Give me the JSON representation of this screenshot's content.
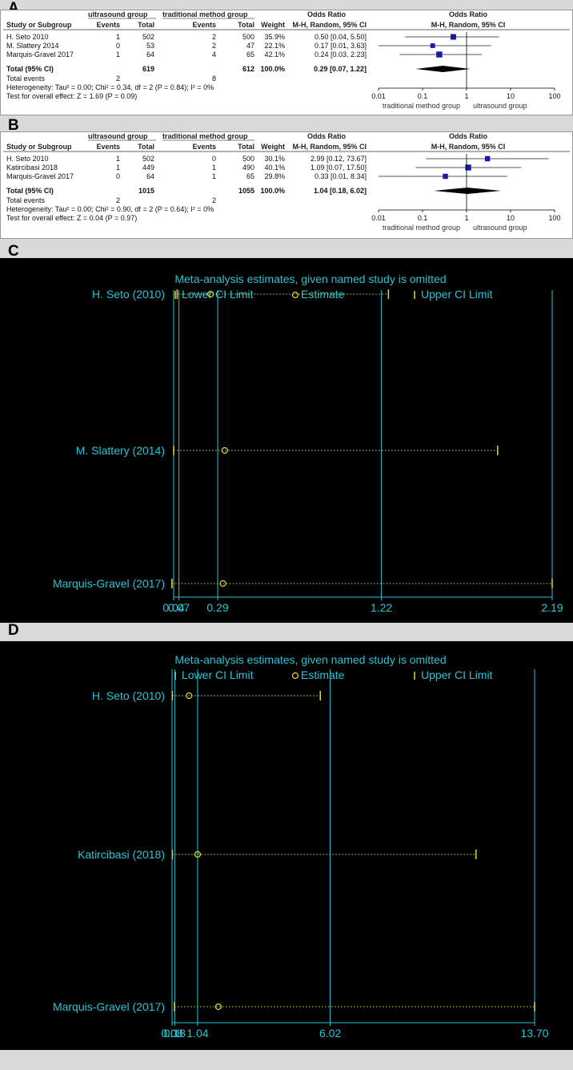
{
  "forest_plots": [
    {
      "panel": "A",
      "headers": {
        "group1": "ultrasound group",
        "group2": "traditional method group",
        "or_col": "Odds Ratio",
        "study": "Study or Subgroup",
        "events": "Events",
        "total": "Total",
        "weight": "Weight",
        "method": "M-H, Random, 95% CI"
      },
      "studies": [
        {
          "name": "H. Seto 2010",
          "e1": "1",
          "t1": "502",
          "e2": "2",
          "t2": "500",
          "weight": "35.9%",
          "ci_text": "0.50 [0.04, 5.50]"
        },
        {
          "name": "M. Slattery 2014",
          "e1": "0",
          "t1": "53",
          "e2": "2",
          "t2": "47",
          "weight": "22.1%",
          "ci_text": "0.17 [0.01, 3.63]"
        },
        {
          "name": "Marquis-Gravel 2017",
          "e1": "1",
          "t1": "64",
          "e2": "4",
          "t2": "65",
          "weight": "42.1%",
          "ci_text": "0.24 [0.03, 2.23]"
        }
      ],
      "total": {
        "label": "Total (95% CI)",
        "t1": "619",
        "t2": "612",
        "weight": "100.0%",
        "ci_text": "0.29 [0.07, 1.22]"
      },
      "total_events": {
        "label": "Total events",
        "e1": "2",
        "e2": "8"
      },
      "heterogeneity": "Heterogeneity: Tau² = 0.00; Chi² = 0.34, df = 2 (P = 0.84); I² = 0%",
      "overall_test": "Test for overall effect: Z = 1.69 (P = 0.09)",
      "axis": {
        "ticks": [
          "0.01",
          "0.1",
          "1",
          "10",
          "100"
        ],
        "favours_left": "traditional method group",
        "favours_right": "ultrasound group"
      }
    },
    {
      "panel": "B",
      "headers": {
        "group1": "ultrasound group",
        "group2": "traditional method group",
        "or_col": "Odds Ratio",
        "study": "Study or Subgroup",
        "events": "Events",
        "total": "Total",
        "weight": "Weight",
        "method": "M-H, Random, 95% CI"
      },
      "studies": [
        {
          "name": "H. Seto 2010",
          "e1": "1",
          "t1": "502",
          "e2": "0",
          "t2": "500",
          "weight": "30.1%",
          "ci_text": "2.99 [0.12, 73.67]"
        },
        {
          "name": "Katircibasi 2018",
          "e1": "1",
          "t1": "449",
          "e2": "1",
          "t2": "490",
          "weight": "40.1%",
          "ci_text": "1.09 [0.07, 17.50]"
        },
        {
          "name": "Marquis-Gravel 2017",
          "e1": "0",
          "t1": "64",
          "e2": "1",
          "t2": "65",
          "weight": "29.8%",
          "ci_text": "0.33 [0.01, 8.34]"
        }
      ],
      "total": {
        "label": "Total (95% CI)",
        "t1": "1015",
        "t2": "1055",
        "weight": "100.0%",
        "ci_text": "1.04 [0.18, 6.02]"
      },
      "total_events": {
        "label": "Total events",
        "e1": "2",
        "e2": "2"
      },
      "heterogeneity": "Heterogeneity: Tau² = 0.00; Chi² = 0.90, df = 2 (P = 0.64); I² = 0%",
      "overall_test": "Test for overall effect: Z = 0.04 (P = 0.97)",
      "axis": {
        "ticks": [
          "0.01",
          "0.1",
          "1",
          "10",
          "100"
        ],
        "favours_left": "traditional method group",
        "favours_right": "ultrasound group"
      }
    }
  ],
  "sensitivity_plots": [
    {
      "panel": "C",
      "title": "Meta-analysis estimates, given named study is omitted",
      "legend": {
        "lower": "Lower CI Limit",
        "estimate": "Estimate",
        "upper": "Upper CI Limit"
      },
      "rows": [
        {
          "study": "H. Seto (2010)",
          "lower": 0.06,
          "estimate": 0.25,
          "upper": 1.26
        },
        {
          "study": "M. Slattery (2014)",
          "lower": 0.04,
          "estimate": 0.33,
          "upper": 1.88
        },
        {
          "study": "Marquis-Gravel (2017)",
          "lower": 0.03,
          "estimate": 0.32,
          "upper": 2.19
        }
      ],
      "ref_lines": {
        "lower": 0.07,
        "estimate": 0.29,
        "upper": 1.22
      },
      "tick_labels": [
        {
          "label": "0.04",
          "value": 0.04
        },
        {
          "label": "0.07",
          "value": 0.07
        },
        {
          "label": "0.29",
          "value": 0.29
        },
        {
          "label": "1.22",
          "value": 1.22
        },
        {
          "label": "2.19",
          "value": 2.19
        }
      ],
      "xlim": [
        0.04,
        2.19
      ]
    },
    {
      "panel": "D",
      "title": "Meta-analysis estimates, given named study is omitted",
      "legend": {
        "lower": "Lower CI Limit",
        "estimate": "Estimate",
        "upper": "Upper CI Limit"
      },
      "rows": [
        {
          "study": "H. Seto (2010)",
          "lower": 0.09,
          "estimate": 0.72,
          "upper": 5.65
        },
        {
          "study": "Katircibasi (2018)",
          "lower": 0.09,
          "estimate": 1.04,
          "upper": 11.5
        },
        {
          "study": "Marquis-Gravel (2017)",
          "lower": 0.17,
          "estimate": 1.82,
          "upper": 13.7
        }
      ],
      "ref_lines": {
        "lower": 0.18,
        "estimate": 1.04,
        "upper": 6.02
      },
      "tick_labels": [
        {
          "label": "0.08",
          "value": 0.08
        },
        {
          "label": "0.18",
          "value": 0.18
        },
        {
          "label": "1.04",
          "value": 1.04
        },
        {
          "label": "6.02",
          "value": 6.02
        },
        {
          "label": "13.70",
          "value": 13.7
        }
      ],
      "xlim": [
        0.08,
        13.7
      ]
    }
  ],
  "chart_data": [
    {
      "type": "forest",
      "panel": "A",
      "scale": "log",
      "xlim": [
        0.01,
        100
      ],
      "studies": [
        {
          "name": "H. Seto 2010",
          "or": 0.5,
          "lower": 0.04,
          "upper": 5.5,
          "weight": 35.9
        },
        {
          "name": "M. Slattery 2014",
          "or": 0.17,
          "lower": 0.01,
          "upper": 3.63,
          "weight": 22.1
        },
        {
          "name": "Marquis-Gravel 2017",
          "or": 0.24,
          "lower": 0.03,
          "upper": 2.23,
          "weight": 42.1
        }
      ],
      "pooled": {
        "or": 0.29,
        "lower": 0.07,
        "upper": 1.22
      }
    },
    {
      "type": "forest",
      "panel": "B",
      "scale": "log",
      "xlim": [
        0.01,
        100
      ],
      "studies": [
        {
          "name": "H. Seto 2010",
          "or": 2.99,
          "lower": 0.12,
          "upper": 73.67,
          "weight": 30.1
        },
        {
          "name": "Katircibasi 2018",
          "or": 1.09,
          "lower": 0.07,
          "upper": 17.5,
          "weight": 40.1
        },
        {
          "name": "Marquis-Gravel 2017",
          "or": 0.33,
          "lower": 0.01,
          "upper": 8.34,
          "weight": 29.8
        }
      ],
      "pooled": {
        "or": 1.04,
        "lower": 0.18,
        "upper": 6.02
      }
    },
    {
      "type": "sensitivity",
      "panel": "C",
      "title": "Meta-analysis estimates, given named study is omitted",
      "series": [
        {
          "study": "H. Seto (2010)",
          "lower": 0.06,
          "estimate": 0.25,
          "upper": 1.26
        },
        {
          "study": "M. Slattery (2014)",
          "lower": 0.04,
          "estimate": 0.33,
          "upper": 1.88
        },
        {
          "study": "Marquis-Gravel (2017)",
          "lower": 0.03,
          "estimate": 0.32,
          "upper": 2.19
        }
      ],
      "reference": {
        "lower": 0.07,
        "estimate": 0.29,
        "upper": 1.22
      }
    },
    {
      "type": "sensitivity",
      "panel": "D",
      "title": "Meta-analysis estimates, given named study is omitted",
      "series": [
        {
          "study": "H. Seto (2010)",
          "lower": 0.09,
          "estimate": 0.72,
          "upper": 5.65
        },
        {
          "study": "Katircibasi (2018)",
          "lower": 0.09,
          "estimate": 1.04,
          "upper": 11.5
        },
        {
          "study": "Marquis-Gravel (2017)",
          "lower": 0.17,
          "estimate": 1.82,
          "upper": 13.7
        }
      ],
      "reference": {
        "lower": 0.18,
        "estimate": 1.04,
        "upper": 6.02
      }
    }
  ],
  "colors": {
    "forest_square": "#1a1aa6",
    "sensitivity_bg": "#000000",
    "sensitivity_lines": "#29c4d8",
    "sensitivity_markers": "#e0d83a",
    "panel_bg": "#d9d9d9"
  }
}
